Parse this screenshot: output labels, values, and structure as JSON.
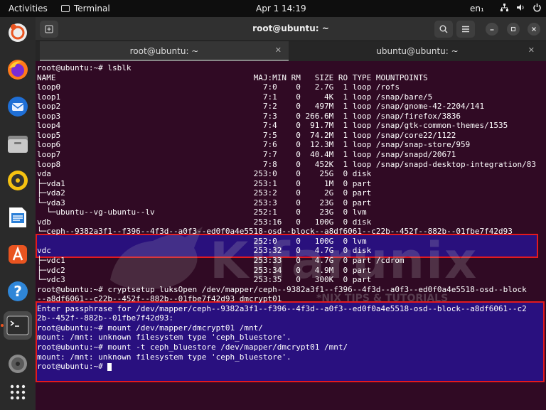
{
  "topbar": {
    "activities": "Activities",
    "app_name": "Terminal",
    "clock": "Apr 1  14:19",
    "language": "en₁",
    "tray_network_icon": "network-icon",
    "tray_volume_icon": "volume-icon",
    "tray_power_icon": "power-icon"
  },
  "dock": {
    "items": [
      {
        "name": "help-icon",
        "label": ""
      },
      {
        "name": "firefox-icon"
      },
      {
        "name": "thunderbird-icon"
      },
      {
        "name": "files-icon"
      },
      {
        "name": "rhythmbox-icon"
      },
      {
        "name": "writer-icon"
      },
      {
        "name": "app-center-icon"
      },
      {
        "name": "help-icon"
      },
      {
        "name": "terminal-icon"
      },
      {
        "name": "disc-icon"
      },
      {
        "name": "show-apps-icon"
      }
    ],
    "accent": "#e95420"
  },
  "window": {
    "title": "root@ubuntu: ~",
    "tabs": [
      {
        "label": "root@ubuntu: ~",
        "close": "✕",
        "active": true
      },
      {
        "label": "ubuntu@ubuntu: ~",
        "close": "✕",
        "active": false
      }
    ],
    "bg_color": "#300a24"
  },
  "watermark": {
    "text": "Kifarunix",
    "subtext": "*NIX TIPS & TUTORIALS"
  },
  "terminal": {
    "lines": [
      "root@ubuntu:~# lsblk",
      "NAME                                          MAJ:MIN RM   SIZE RO TYPE MOUNTPOINTS",
      "loop0                                           7:0    0   2.7G  1 loop /rofs",
      "loop1                                           7:1    0     4K  1 loop /snap/bare/5",
      "loop2                                           7:2    0   497M  1 loop /snap/gnome-42-2204/141",
      "loop3                                           7:3    0 266.6M  1 loop /snap/firefox/3836",
      "loop4                                           7:4    0  91.7M  1 loop /snap/gtk-common-themes/1535",
      "loop5                                           7:5    0  74.2M  1 loop /snap/core22/1122",
      "loop6                                           7:6    0  12.3M  1 loop /snap/snap-store/959",
      "loop7                                           7:7    0  40.4M  1 loop /snap/snapd/20671",
      "loop8                                           7:8    0   452K  1 loop /snap/snapd-desktop-integration/83",
      "vda                                           253:0    0    25G  0 disk",
      "├─vda1                                        253:1    0     1M  0 part",
      "├─vda2                                        253:2    0     2G  0 part",
      "└─vda3                                        253:3    0    23G  0 part",
      "  └─ubuntu--vg-ubuntu--lv                     252:1    0    23G  0 lvm",
      "vdb                                           253:16   0   100G  0 disk",
      "└─ceph--9382a3f1--f396--4f3d--a0f3--ed0f0a4e5518-osd--block--a8df6061--c22b--452f--882b--01fbe7f42d93",
      "                                              252:0    0   100G  0 lvm",
      "vdc                                           253:32   0   4.7G  0 disk",
      "├─vdc1                                        253:33   0   4.7G  0 part /cdrom",
      "├─vdc2                                        253:34   0   4.9M  0 part",
      "└─vdc3                                        253:35   0   300K  0 part",
      "root@ubuntu:~# cryptsetup luksOpen /dev/mapper/ceph--9382a3f1--f396--4f3d--a0f3--ed0f0a4e5518-osd--block",
      "--a8df6061--c22b--452f--882b--01fbe7f42d93 dmcrypt01",
      "Enter passphrase for /dev/mapper/ceph--9382a3f1--f396--4f3d--a0f3--ed0f0a4e5518-osd--block--a8df6061--c2",
      "2b--452f--882b--01fbe7f42d93:",
      "root@ubuntu:~# mount /dev/mapper/dmcrypt01 /mnt/",
      "mount: /mnt: unknown filesystem type 'ceph_bluestore'.",
      "root@ubuntu:~# mount -t ceph_bluestore /dev/mapper/dmcrypt01 /mnt/",
      "mount: /mnt: unknown filesystem type 'ceph_bluestore'.",
      "root@ubuntu:~# "
    ]
  }
}
